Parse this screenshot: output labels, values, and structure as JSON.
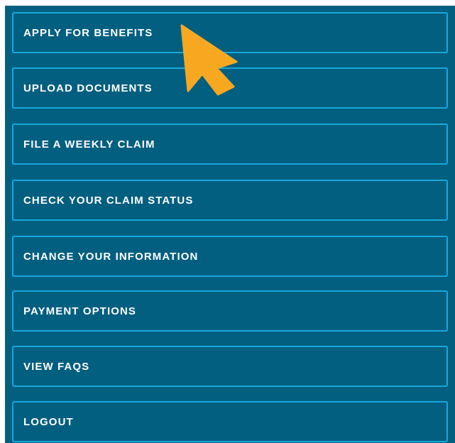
{
  "menu": {
    "items": [
      {
        "label": "APPLY FOR BENEFITS"
      },
      {
        "label": "UPLOAD DOCUMENTS"
      },
      {
        "label": "FILE A WEEKLY CLAIM"
      },
      {
        "label": "CHECK YOUR CLAIM STATUS"
      },
      {
        "label": "CHANGE YOUR INFORMATION"
      },
      {
        "label": "PAYMENT OPTIONS"
      },
      {
        "label": "VIEW FAQS"
      },
      {
        "label": "LOGOUT"
      }
    ]
  },
  "colors": {
    "panel_background": "#035f80",
    "button_border": "#1aa6dd",
    "button_text": "#ffffff",
    "cursor_fill": "#f8a820"
  },
  "icons": {
    "cursor": "arrow-cursor-icon"
  }
}
